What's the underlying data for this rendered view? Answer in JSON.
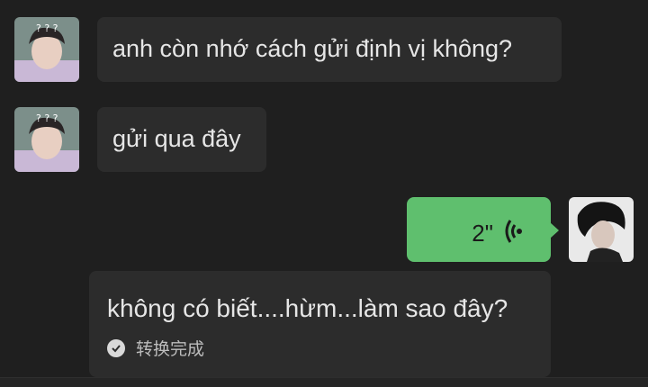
{
  "messages": [
    {
      "sender": "other",
      "text": "anh còn nhớ cách gửi định vị không?"
    },
    {
      "sender": "other",
      "text": "gửi qua đây"
    },
    {
      "sender": "self",
      "type": "voice",
      "duration": "2\""
    },
    {
      "type": "transcript",
      "text": "không có biết....hừm...làm sao đây?",
      "status": "转换完成"
    }
  ],
  "colors": {
    "outgoing_bubble": "#5fbf6e",
    "incoming_bubble": "#2c2c2c",
    "background": "#1f1f1f"
  }
}
